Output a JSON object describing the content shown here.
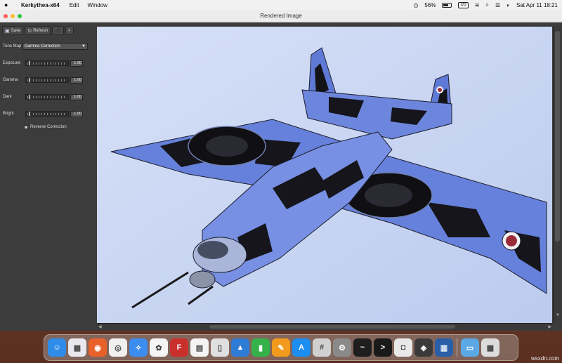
{
  "menubar": {
    "app_name": "Kerkythea-x64",
    "items": [
      "Edit",
      "Window"
    ],
    "battery": "56%",
    "battery_level": 0.56,
    "input_source": "US",
    "datetime": "Sat Apr 11  18:21"
  },
  "window": {
    "title": "Rendered Image"
  },
  "toolbar": {
    "save_label": "Save",
    "refresh_label": "Refresh"
  },
  "controls": {
    "tone_map_label": "Tone Map",
    "tone_map_value": "Gamma Correction",
    "sliders": [
      {
        "label": "Exposure",
        "value": "1.00",
        "position": 0.05
      },
      {
        "label": "Gamma",
        "value": "1.00",
        "position": 0.05
      },
      {
        "label": "Dark",
        "value": "1.00",
        "position": 0.05
      },
      {
        "label": "Bright",
        "value": "1.00",
        "position": 0.05
      }
    ],
    "reverse_correction_label": "Reverse Correction",
    "reverse_correction_checked": true
  },
  "dock": {
    "apps": [
      {
        "name": "finder",
        "color": "#2f8ce8",
        "glyph": "☺"
      },
      {
        "name": "launchpad",
        "color": "#e8e8ee",
        "glyph": "▦"
      },
      {
        "name": "firefox",
        "color": "#e8602a",
        "glyph": "◉"
      },
      {
        "name": "chrome",
        "color": "#f0f0f0",
        "glyph": "◎"
      },
      {
        "name": "safari",
        "color": "#3b8df0",
        "glyph": "✧"
      },
      {
        "name": "photos",
        "color": "#f5f5f5",
        "glyph": "✿"
      },
      {
        "name": "filezilla",
        "color": "#c9302c",
        "glyph": "F"
      },
      {
        "name": "notes",
        "color": "#f4f4f4",
        "glyph": "▤"
      },
      {
        "name": "preview",
        "color": "#e0e0e0",
        "glyph": "▯"
      },
      {
        "name": "keynote",
        "color": "#2e7cd6",
        "glyph": "▲"
      },
      {
        "name": "numbers",
        "color": "#35b24a",
        "glyph": "▮"
      },
      {
        "name": "pages",
        "color": "#f29a1e",
        "glyph": "✎"
      },
      {
        "name": "app-store",
        "color": "#1c8ef2",
        "glyph": "A"
      },
      {
        "name": "calculator",
        "color": "#d0d0d0",
        "glyph": "#"
      },
      {
        "name": "system-preferences",
        "color": "#8a8a8a",
        "glyph": "⚙"
      },
      {
        "name": "activity-monitor",
        "color": "#1e1e1e",
        "glyph": "~"
      },
      {
        "name": "terminal",
        "color": "#1a1a1a",
        "glyph": ">"
      },
      {
        "name": "screenshot",
        "color": "#e8e8e8",
        "glyph": "◘"
      },
      {
        "name": "kerkythea",
        "color": "#3a3a3a",
        "glyph": "◈"
      },
      {
        "name": "disk-utility",
        "color": "#2a5fa8",
        "glyph": "▥"
      }
    ],
    "trailing": [
      {
        "name": "downloads-folder",
        "color": "#5aa9e6",
        "glyph": "▭"
      },
      {
        "name": "trash",
        "color": "#dcdcdc",
        "glyph": "▩"
      }
    ]
  },
  "watermark": "wsxdn.com"
}
